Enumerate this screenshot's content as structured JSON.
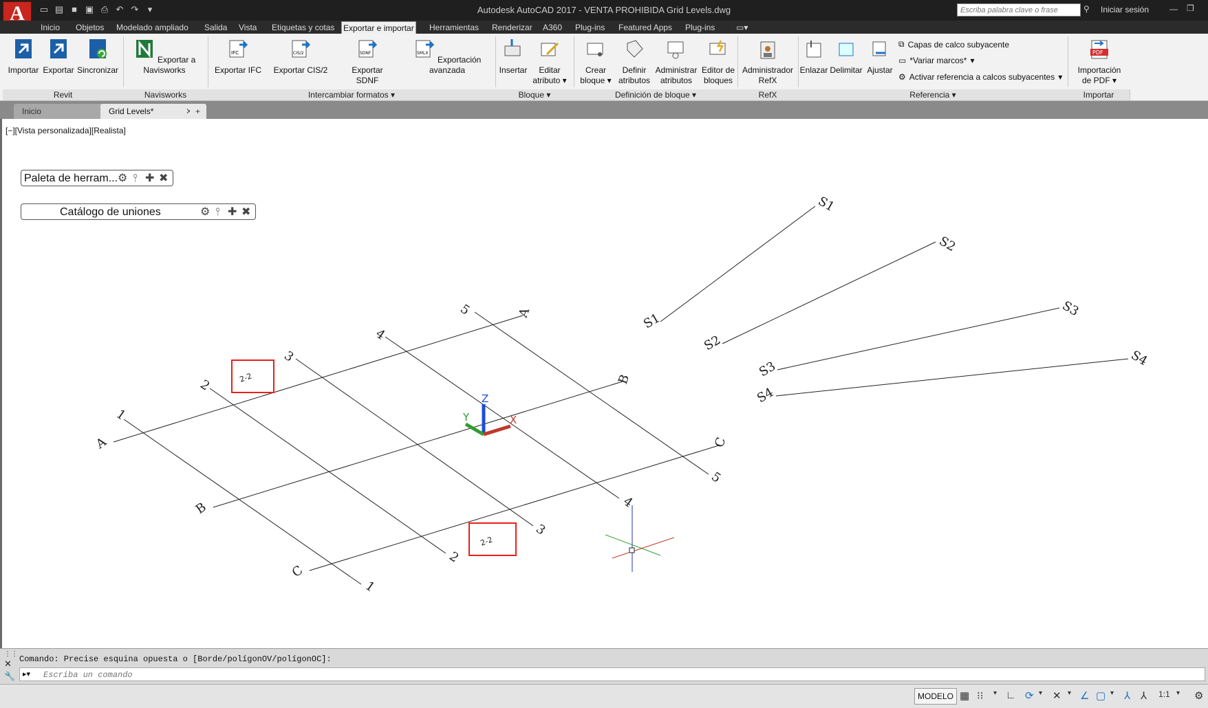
{
  "window": {
    "title": "Autodesk AutoCAD 2017 - VENTA PROHIBIDA    Grid Levels.dwg",
    "search_placeholder": "Escriba palabra clave o frase",
    "signin_label": "Iniciar sesión",
    "app_letter": "A"
  },
  "menu_tabs": [
    "Inicio",
    "Objetos",
    "Modelado ampliado",
    "Salida",
    "Vista",
    "Etiquetas y cotas",
    "Exportar e importar",
    "Herramientas",
    "Renderizar",
    "A360",
    "Plug-ins",
    "Featured Apps",
    "Plug-ins"
  ],
  "active_menu_tab": "Exportar e importar",
  "ribbon": {
    "revit": {
      "label": "Revit",
      "importar": "Importar",
      "exportar": "Exportar",
      "sincronizar": "Sincronizar"
    },
    "navisworks": {
      "label": "Navisworks",
      "exportar": "Exportar a Navisworks"
    },
    "formatos": {
      "label": "Intercambiar formatos",
      "ifc": "Exportar IFC",
      "cis2": "Exportar CIS/2",
      "sdnf": "Exportar SDNF",
      "avanzada": "Exportación avanzada",
      "ifc_tag": "IFC",
      "cis_tag": "CIS/2",
      "sdnf_tag": "SDNF",
      "smlx_tag": "SMLX"
    },
    "bloque": {
      "label": "Bloque",
      "insertar": "Insertar",
      "editar_1": "Editar",
      "editar_2": "atributo"
    },
    "definicion": {
      "label": "Definición de bloque",
      "crear_1": "Crear",
      "crear_2": "bloque",
      "definir_1": "Definir",
      "definir_2": "atributos",
      "admin_1": "Administrar",
      "admin_2": "atributos",
      "editor_1": "Editor de",
      "editor_2": "bloques"
    },
    "refx": {
      "label": "RefX",
      "admin_1": "Administrador",
      "admin_2": "RefX"
    },
    "referencia": {
      "label": "Referencia",
      "enlazar": "Enlazar",
      "delimitar": "Delimitar",
      "ajustar": "Ajustar",
      "capas": "Capas de calco subyacente",
      "variar": "*Variar marcos*",
      "activar": "Activar referencia a calcos subyacentes"
    },
    "importar": {
      "label": "Importar",
      "pdf_1": "Importación",
      "pdf_2": "de PDF",
      "pdf_tag": "PDF"
    }
  },
  "doc_tabs": {
    "inicio": "Inicio",
    "grid": "Grid Levels*",
    "close": "✕",
    "add": "+"
  },
  "viewport": {
    "label": "[−][Vista personalizada][Realista]",
    "palette_1": "Paleta de herram...",
    "palette_2": "Catálogo de uniones",
    "axis_x": "X",
    "axis_y": "Y",
    "axis_z": "Z",
    "grid_labels": {
      "l1": "1",
      "l2": "2",
      "l3": "3",
      "l4": "4",
      "l5": "5",
      "a": "A",
      "b": "B",
      "c": "C",
      "s1": "S1",
      "s2": "S2",
      "s3": "S3",
      "s4": "S4",
      "highlight": "2-2"
    }
  },
  "command": {
    "history": "Comando: Precise esquina opuesta o [Borde/polígonOV/polígonOC]:",
    "placeholder": "Escriba un comando"
  },
  "status": {
    "modelo": "MODELO",
    "scale": "1:1"
  },
  "colors": {
    "app_red": "#c8261e",
    "highlight_red": "#e8201a",
    "axis_x": "#c0392b",
    "axis_y": "#2e9e2e",
    "axis_z": "#1d4ed8"
  }
}
